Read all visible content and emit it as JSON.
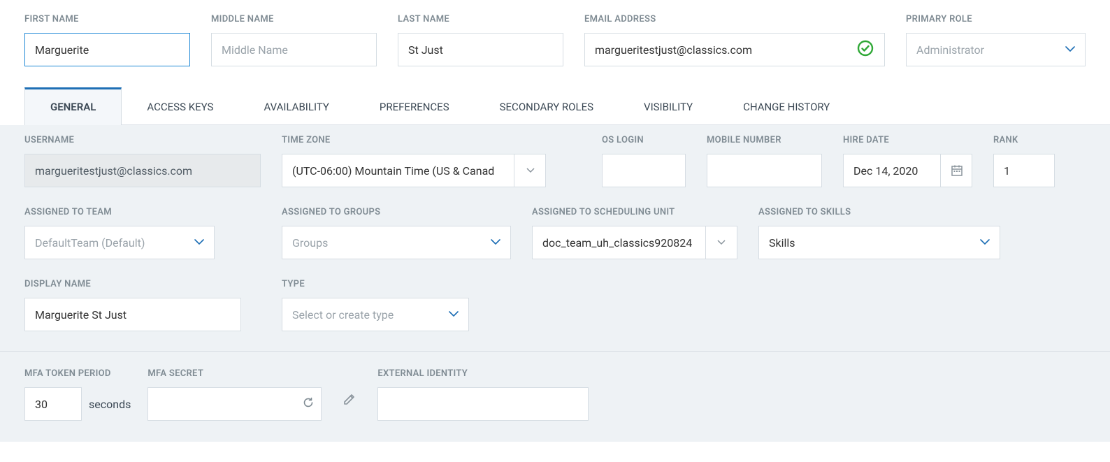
{
  "top": {
    "firstNameLabel": "FIRST NAME",
    "firstName": "Marguerite",
    "middleNameLabel": "MIDDLE NAME",
    "middleNamePlaceholder": "Middle Name",
    "lastNameLabel": "LAST NAME",
    "lastName": "St Just",
    "emailLabel": "EMAIL ADDRESS",
    "email": "margueritestjust@classics.com",
    "roleLabel": "PRIMARY ROLE",
    "role": "Administrator"
  },
  "tabs": {
    "general": "GENERAL",
    "accessKeys": "ACCESS KEYS",
    "availability": "AVAILABILITY",
    "preferences": "PREFERENCES",
    "secondaryRoles": "SECONDARY ROLES",
    "visibility": "VISIBILITY",
    "changeHistory": "CHANGE HISTORY"
  },
  "general": {
    "usernameLabel": "USERNAME",
    "username": "margueritestjust@classics.com",
    "tzLabel": "TIME ZONE",
    "tz": "(UTC-06:00) Mountain Time (US & Canad",
    "osLoginLabel": "OS LOGIN",
    "mobileLabel": "MOBILE NUMBER",
    "hireDateLabel": "HIRE DATE",
    "hireDate": "Dec 14, 2020",
    "rankLabel": "RANK",
    "rank": "1",
    "teamLabel": "ASSIGNED TO TEAM",
    "team": "DefaultTeam (Default)",
    "groupsLabel": "ASSIGNED TO GROUPS",
    "groups": "Groups",
    "schedLabel": "ASSIGNED TO SCHEDULING UNIT",
    "sched": "doc_team_uh_classics920824",
    "skillsLabel": "ASSIGNED TO SKILLS",
    "skills": "Skills",
    "displayNameLabel": "DISPLAY NAME",
    "displayName": "Marguerite St Just",
    "typeLabel": "TYPE",
    "typePlaceholder": "Select or create type",
    "mfaPeriodLabel": "MFA TOKEN PERIOD",
    "mfaPeriod": "30",
    "secondsLabel": "seconds",
    "mfaSecretLabel": "MFA SECRET",
    "externalIdLabel": "EXTERNAL IDENTITY"
  }
}
